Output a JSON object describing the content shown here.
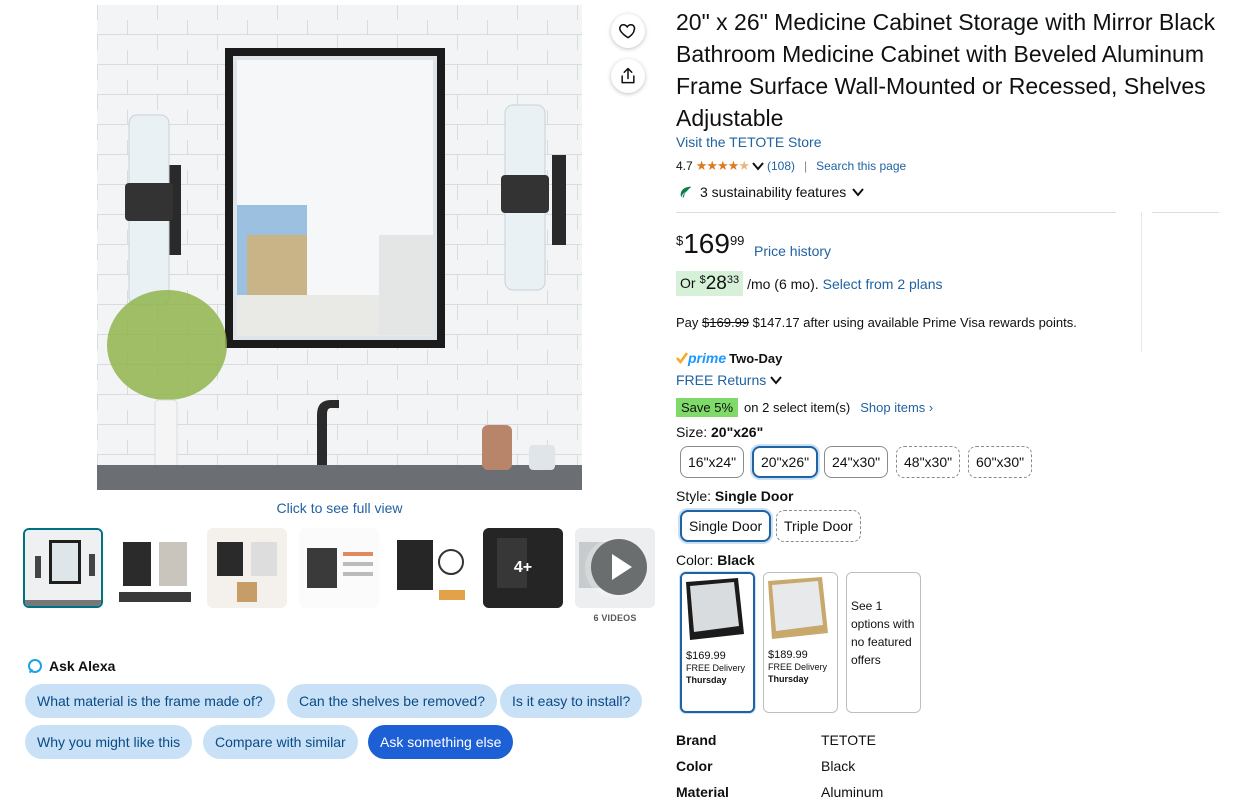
{
  "product": {
    "title": "20\" x 26\" Medicine Cabinet Storage with Mirror Black Bathroom Medicine Cabinet with Beveled Aluminum Frame Surface Wall-Mounted or Recessed, Shelves Adjustable",
    "store_link": "Visit the TETOTE Store",
    "rating": "4.7",
    "stars_icon": "star-rating-icon",
    "review_count": "(108)",
    "separator": "|",
    "search_page": "Search this page",
    "sustainability": "3 sustainability features"
  },
  "media": {
    "full_view": "Click to see full view",
    "thumb_more": "4+",
    "video_label": "6 VIDEOS"
  },
  "price": {
    "symbol": "$",
    "whole": "169",
    "fraction": "99",
    "history_link": "Price history",
    "monthly_or": "Or",
    "monthly_symbol": "$",
    "monthly_whole": "28",
    "monthly_fraction": "33",
    "monthly_suffix": "/mo (6 mo).",
    "plans_link": "Select from 2 plans",
    "pay_prefix": "Pay",
    "pay_original": "$169.99",
    "pay_rest": "$147.17 after using available Prime Visa rewards points."
  },
  "delivery": {
    "prime_word": "prime",
    "two_day": "Two-Day",
    "returns": "FREE Returns"
  },
  "promo": {
    "badge": "Save 5%",
    "text": "on 2 select item(s)",
    "link": "Shop items ›"
  },
  "size": {
    "label": "Size:",
    "selected": "20\"x26\"",
    "options": [
      "16\"x24\"",
      "20\"x26\"",
      "24\"x30\"",
      "48\"x30\"",
      "60\"x30\""
    ]
  },
  "style": {
    "label": "Style:",
    "selected": "Single Door",
    "options": [
      "Single Door",
      "Triple Door"
    ]
  },
  "color": {
    "label": "Color:",
    "selected": "Black",
    "cards": [
      {
        "price": "$169.99",
        "delivery": "FREE Delivery",
        "day": "Thursday"
      },
      {
        "price": "$189.99",
        "delivery": "FREE Delivery",
        "day": "Thursday"
      }
    ],
    "see_more": "See 1 options with no featured offers"
  },
  "specs": [
    {
      "key": "Brand",
      "value": "TETOTE"
    },
    {
      "key": "Color",
      "value": "Black"
    },
    {
      "key": "Material",
      "value": "Aluminum"
    }
  ],
  "alexa": {
    "title": "Ask Alexa",
    "chips": [
      "What material is the frame made of?",
      "Can the shelves be removed?",
      "Is it easy to install?",
      "Why you might like this",
      "Compare with similar",
      "Ask something else"
    ]
  },
  "colors": {
    "link": "#2162A1",
    "price_orange": "#DE7921",
    "prime_blue": "#1a98ff",
    "save_green": "#7fda69",
    "alexa_chip": "#c8e1f7",
    "alexa_primary": "#1d5fd4"
  }
}
